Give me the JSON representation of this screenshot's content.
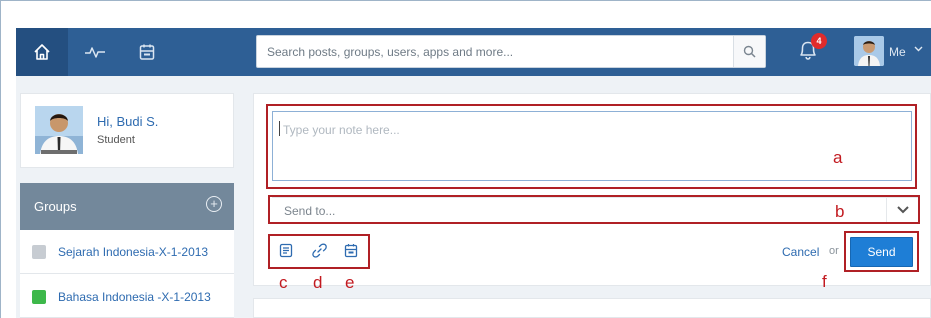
{
  "search": {
    "placeholder": "Search posts, groups, users, apps and more..."
  },
  "topbar": {
    "notifications_count": "4",
    "me_label": "Me"
  },
  "profile": {
    "greeting": "Hi, Budi S.",
    "role": "Student"
  },
  "groups": {
    "title": "Groups",
    "items": [
      {
        "name": "Sejarah Indonesia-X-1-2013",
        "color": "#c7ccd2"
      },
      {
        "name": "Bahasa Indonesia -X-1-2013",
        "color": "#3db84a"
      }
    ]
  },
  "composer": {
    "note_placeholder": "Type your note here...",
    "sendto_placeholder": "Send to...",
    "cancel_label": "Cancel",
    "or_label": "or",
    "send_label": "Send"
  },
  "annotations": {
    "a": "a",
    "b": "b",
    "c": "c",
    "d": "d",
    "e": "e",
    "f": "f"
  },
  "colors": {
    "topbar": "#2e5f95",
    "accent": "#1e7ed6",
    "annotation": "#b02025"
  }
}
